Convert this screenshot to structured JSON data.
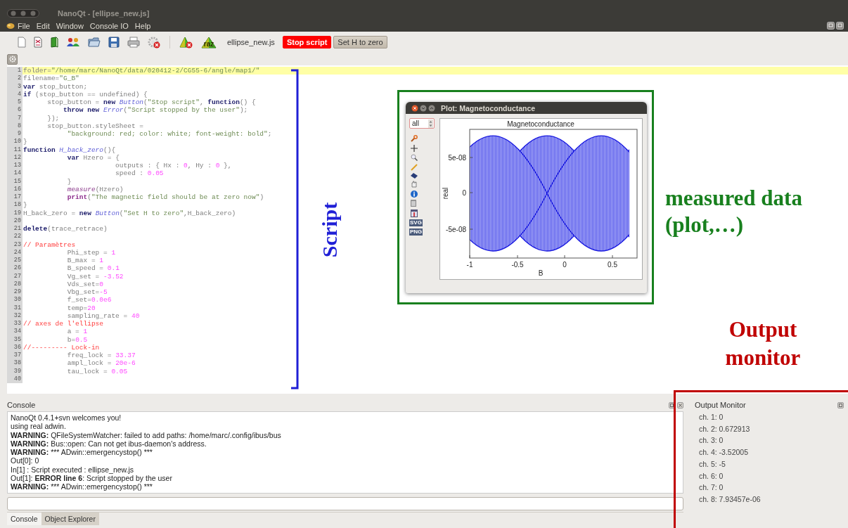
{
  "window": {
    "title": "NanoQt - [ellipse_new.js]"
  },
  "menu": [
    {
      "label": "File"
    },
    {
      "label": "Edit"
    },
    {
      "label": "Window"
    },
    {
      "label": "Console IO"
    },
    {
      "label": "Help"
    }
  ],
  "toolbar": {
    "reset_label": "raz",
    "file_name": "ellipse_new.js",
    "buttons": [
      {
        "label": "Stop script",
        "kind": "danger"
      },
      {
        "label": "Set H to zero",
        "kind": "normal"
      }
    ]
  },
  "editor": {
    "lines": [
      {
        "no": "1",
        "current": true,
        "tokens": [
          {
            "kind": "text",
            "text": "folder="
          },
          {
            "kind": "string",
            "text": "\"/home/marc/NanoQt/data/020412-2/CG55-6/angle/map1/\""
          }
        ]
      },
      {
        "no": "2",
        "current": false,
        "tokens": [
          {
            "kind": "text",
            "text": "filename="
          },
          {
            "kind": "string",
            "text": "\"G_B\""
          }
        ]
      },
      {
        "no": "3",
        "current": false,
        "tokens": [
          {
            "kind": "keyword",
            "text": "var"
          },
          {
            "kind": "text",
            "text": " stop_button;"
          }
        ]
      },
      {
        "no": "4",
        "current": false,
        "tokens": [
          {
            "kind": "keyword",
            "text": "if"
          },
          {
            "kind": "text",
            "text": " (stop_button == undefined) {"
          }
        ]
      },
      {
        "no": "5",
        "current": false,
        "tokens": [
          {
            "kind": "text",
            "text": "      stop_button = "
          },
          {
            "kind": "keyword",
            "text": "new"
          },
          {
            "kind": "class",
            "text": " Button"
          },
          {
            "kind": "text",
            "text": "("
          },
          {
            "kind": "string",
            "text": "\"Stop script\""
          },
          {
            "kind": "text",
            "text": ", "
          },
          {
            "kind": "keyword",
            "text": "function"
          },
          {
            "kind": "text",
            "text": "() {"
          }
        ]
      },
      {
        "no": "6",
        "current": false,
        "tokens": [
          {
            "kind": "keyword",
            "text": "          throw"
          },
          {
            "kind": "keyword",
            "text": " new"
          },
          {
            "kind": "class",
            "text": " Error"
          },
          {
            "kind": "text",
            "text": "("
          },
          {
            "kind": "string",
            "text": "\"Script stopped by the user\""
          },
          {
            "kind": "text",
            "text": ");"
          }
        ]
      },
      {
        "no": "7",
        "current": false,
        "tokens": [
          {
            "kind": "text",
            "text": "      });"
          }
        ]
      },
      {
        "no": "8",
        "current": false,
        "tokens": [
          {
            "kind": "text",
            "text": "      stop_button.styleSheet ="
          }
        ]
      },
      {
        "no": "9",
        "current": false,
        "tokens": [
          {
            "kind": "string",
            "text": "           \"background: red; color: white; font-weight: bold\""
          },
          {
            "kind": "text",
            "text": ";"
          }
        ]
      },
      {
        "no": "10",
        "current": false,
        "tokens": [
          {
            "kind": "text",
            "text": "}"
          }
        ]
      },
      {
        "no": "11",
        "current": false,
        "tokens": [
          {
            "kind": "keyword",
            "text": "function"
          },
          {
            "kind": "class",
            "text": " H_back_zero"
          },
          {
            "kind": "text",
            "text": "(){"
          }
        ]
      },
      {
        "no": "12",
        "current": false,
        "tokens": [
          {
            "kind": "keyword",
            "text": "           var"
          },
          {
            "kind": "text",
            "text": " Hzero = {"
          }
        ]
      },
      {
        "no": "13",
        "current": false,
        "tokens": [
          {
            "kind": "text",
            "text": "                       outputs : { Hx : "
          },
          {
            "kind": "number",
            "text": "0"
          },
          {
            "kind": "text",
            "text": ", Hy : "
          },
          {
            "kind": "number",
            "text": "0"
          },
          {
            "kind": "text",
            "text": " },"
          }
        ]
      },
      {
        "no": "14",
        "current": false,
        "tokens": [
          {
            "kind": "text",
            "text": "                       speed : "
          },
          {
            "kind": "number",
            "text": "0.05"
          }
        ]
      },
      {
        "no": "15",
        "current": false,
        "tokens": [
          {
            "kind": "text",
            "text": "           }"
          }
        ]
      },
      {
        "no": "16",
        "current": false,
        "tokens": [
          {
            "kind": "call",
            "text": "           measure"
          },
          {
            "kind": "text",
            "text": "(Hzero)"
          }
        ]
      },
      {
        "no": "17",
        "current": false,
        "tokens": [
          {
            "kind": "builtin",
            "text": "           print"
          },
          {
            "kind": "text",
            "text": "("
          },
          {
            "kind": "string",
            "text": "\"The magnetic field should be at zero now\""
          },
          {
            "kind": "text",
            "text": ")"
          }
        ]
      },
      {
        "no": "18",
        "current": false,
        "tokens": [
          {
            "kind": "text",
            "text": "}"
          }
        ]
      },
      {
        "no": "19",
        "current": false,
        "tokens": [
          {
            "kind": "text",
            "text": "H_back_zero = "
          },
          {
            "kind": "keyword",
            "text": "new"
          },
          {
            "kind": "class",
            "text": " Button"
          },
          {
            "kind": "text",
            "text": "("
          },
          {
            "kind": "string",
            "text": "\"Set H to zero\""
          },
          {
            "kind": "text",
            "text": ",H_back_zero)"
          }
        ]
      },
      {
        "no": "20",
        "current": false
      },
      {
        "no": "21",
        "current": false,
        "tokens": [
          {
            "kind": "keyword",
            "text": "delete"
          },
          {
            "kind": "text",
            "text": "(trace_retrace)"
          }
        ]
      },
      {
        "no": "22",
        "current": false
      },
      {
        "no": "23",
        "current": false,
        "tokens": [
          {
            "kind": "comment",
            "text": "// Paramètres"
          }
        ]
      },
      {
        "no": "24",
        "current": false,
        "tokens": [
          {
            "kind": "text",
            "text": "           Phi_step = "
          },
          {
            "kind": "number",
            "text": "1"
          }
        ]
      },
      {
        "no": "25",
        "current": false,
        "tokens": [
          {
            "kind": "text",
            "text": "           B_max = "
          },
          {
            "kind": "number",
            "text": "1"
          }
        ]
      },
      {
        "no": "26",
        "current": false,
        "tokens": [
          {
            "kind": "text",
            "text": "           B_speed = "
          },
          {
            "kind": "number",
            "text": "0.1"
          }
        ]
      },
      {
        "no": "27",
        "current": false,
        "tokens": [
          {
            "kind": "text",
            "text": "           Vg_set = "
          },
          {
            "kind": "number",
            "text": "-3.52"
          }
        ]
      },
      {
        "no": "28",
        "current": false,
        "tokens": [
          {
            "kind": "text",
            "text": "           Vds_set="
          },
          {
            "kind": "number",
            "text": "0"
          }
        ]
      },
      {
        "no": "29",
        "current": false,
        "tokens": [
          {
            "kind": "text",
            "text": "           Vbg_set="
          },
          {
            "kind": "number",
            "text": "-5"
          }
        ]
      },
      {
        "no": "30",
        "current": false,
        "tokens": [
          {
            "kind": "text",
            "text": "           f_set="
          },
          {
            "kind": "number",
            "text": "0.0e6"
          }
        ]
      },
      {
        "no": "31",
        "current": false,
        "tokens": [
          {
            "kind": "text",
            "text": "           temp="
          },
          {
            "kind": "number",
            "text": "20"
          }
        ]
      },
      {
        "no": "32",
        "current": false,
        "tokens": [
          {
            "kind": "text",
            "text": "           sampling_rate = "
          },
          {
            "kind": "number",
            "text": "40"
          }
        ]
      },
      {
        "no": "33",
        "current": false,
        "tokens": [
          {
            "kind": "comment",
            "text": "// axes de l'ellipse"
          }
        ]
      },
      {
        "no": "34",
        "current": false,
        "tokens": [
          {
            "kind": "text",
            "text": "           a = "
          },
          {
            "kind": "number",
            "text": "1"
          }
        ]
      },
      {
        "no": "35",
        "current": false,
        "tokens": [
          {
            "kind": "text",
            "text": "           b="
          },
          {
            "kind": "number",
            "text": "0.5"
          }
        ]
      },
      {
        "no": "36",
        "current": false,
        "tokens": [
          {
            "kind": "comment",
            "text": "//--------- Lock-in"
          }
        ]
      },
      {
        "no": "37",
        "current": false,
        "tokens": [
          {
            "kind": "text",
            "text": "           freq_lock = "
          },
          {
            "kind": "number",
            "text": "33.37"
          }
        ]
      },
      {
        "no": "38",
        "current": false,
        "tokens": [
          {
            "kind": "text",
            "text": "           ampl_lock = "
          },
          {
            "kind": "number",
            "text": "20e-6"
          }
        ]
      },
      {
        "no": "39",
        "current": false,
        "tokens": [
          {
            "kind": "text",
            "text": "           tau_lock = "
          },
          {
            "kind": "number",
            "text": "0.05"
          }
        ]
      },
      {
        "no": "40",
        "current": false
      }
    ]
  },
  "plot_window": {
    "title": "Plot: Magnetoconductance",
    "selector_value": "all",
    "tool_labels": [
      "SVG",
      "PNG"
    ],
    "chart_title": "Magnetoconductance",
    "ylabel": "real",
    "xlabel": "B",
    "yticks": [
      "5e-08",
      "0",
      "-5e-08"
    ],
    "xticks": [
      "-1",
      "-0.5",
      "0",
      "0.5"
    ]
  },
  "annotations": [
    {
      "kind": "bracket",
      "lines": [
        "Script"
      ],
      "color": "#1f1fd6"
    },
    {
      "kind": "plot-frame",
      "lines": [
        "measured data",
        "(plot,…)"
      ],
      "color": "#18801e"
    },
    {
      "kind": "monitor-frame",
      "lines": [
        "Output",
        "monitor"
      ],
      "color": "#c00000"
    }
  ],
  "console": {
    "title": "Console",
    "lines": [
      {
        "text": "NanoQt 0.4.1+svn welcomes you!"
      },
      {
        "text": "using real adwin."
      },
      {
        "bold_prefix": "WARNING:",
        "text": " QFileSystemWatcher: failed to add paths: /home/marc/.config/ibus/bus"
      },
      {
        "bold_prefix": "WARNING:",
        "text": " Bus::open: Can not get ibus-daemon's address."
      },
      {
        "bold_prefix": "WARNING:",
        "text": " *** ADwin::emergencystop() ***"
      },
      {
        "text": "Out[0]: 0"
      },
      {
        "text": "In[1] : Script executed : ellipse_new.js"
      },
      {
        "text": "Out[1]: **ERROR line 6**: Script stopped by the user"
      },
      {
        "bold_prefix": "WARNING:",
        "text": " *** ADwin::emergencystop() ***"
      }
    ],
    "tabs": [
      {
        "label": "Console",
        "selected": true
      },
      {
        "label": "Object Explorer",
        "selected": false
      }
    ]
  },
  "output_monitor": {
    "title": "Output Monitor",
    "channels": [
      "ch. 1: 0",
      "ch. 2: 0.672913",
      "ch. 3: 0",
      "ch. 4: -3.52005",
      "ch. 5: -5",
      "ch. 6: 0",
      "ch. 7: 0",
      "ch. 8: 7.93457e-06"
    ]
  }
}
